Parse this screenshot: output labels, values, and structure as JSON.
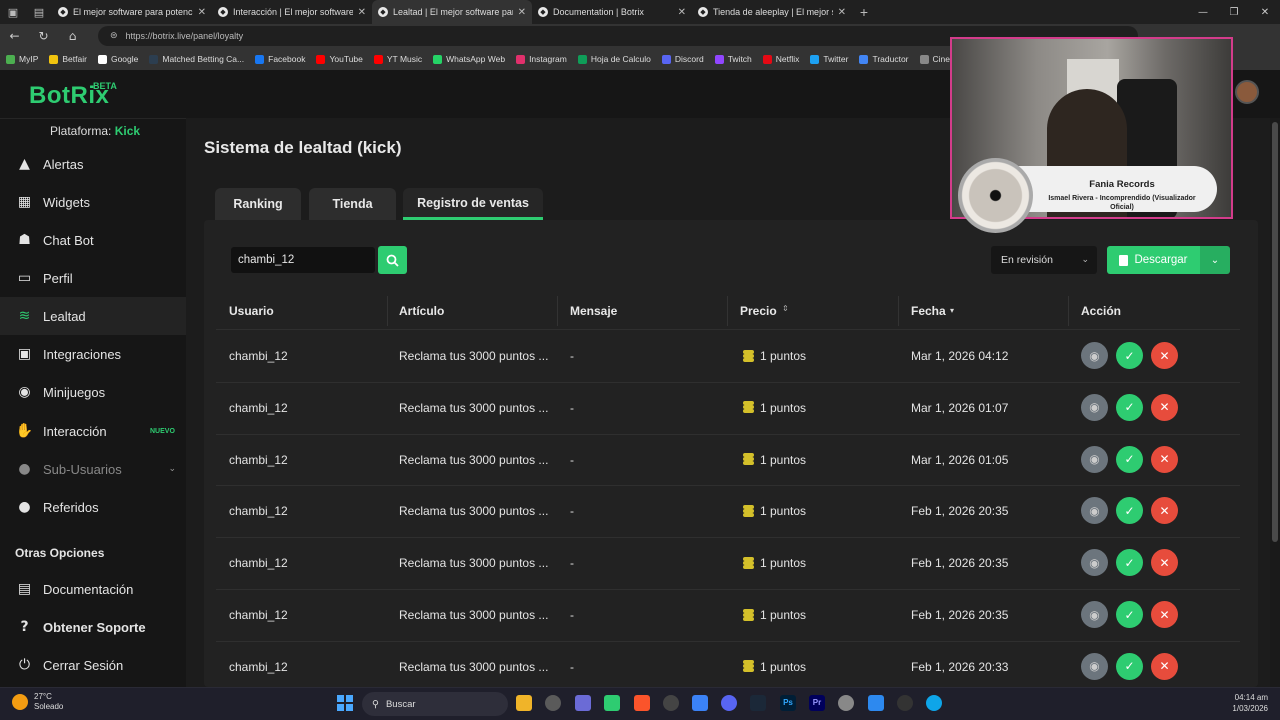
{
  "browser": {
    "tabs": [
      {
        "title": "El mejor software para potenciar"
      },
      {
        "title": "Interacción | El mejor software pa"
      },
      {
        "title": "Lealtad | El mejor software para p"
      },
      {
        "title": "Documentation | Botrix"
      },
      {
        "title": "Tienda de aleeplay | El mejor softw"
      }
    ],
    "active_tab": 2,
    "url": "https://botrix.live/panel/loyalty",
    "bookmarks": [
      {
        "label": "MyIP",
        "color": "#4caf50"
      },
      {
        "label": "Betfair",
        "color": "#f1c40f"
      },
      {
        "label": "Google",
        "color": "#ffffff"
      },
      {
        "label": "Matched Betting Ca...",
        "color": "#2c3e50"
      },
      {
        "label": "Facebook",
        "color": "#1877f2"
      },
      {
        "label": "YouTube",
        "color": "#ff0000"
      },
      {
        "label": "YT Music",
        "color": "#ff0000"
      },
      {
        "label": "WhatsApp Web",
        "color": "#25d366"
      },
      {
        "label": "Instagram",
        "color": "#e1306c"
      },
      {
        "label": "Hoja de Calculo",
        "color": "#0f9d58"
      },
      {
        "label": "Discord",
        "color": "#5865f2"
      },
      {
        "label": "Twitch",
        "color": "#9146ff"
      },
      {
        "label": "Netflix",
        "color": "#e50914"
      },
      {
        "label": "Twitter",
        "color": "#1da1f2"
      },
      {
        "label": "Traductor",
        "color": "#4285f4"
      },
      {
        "label": "Cinepl",
        "color": "#888888"
      }
    ]
  },
  "sidebar": {
    "logo": "BotRix",
    "beta": "BETA",
    "platform_label": "Plataforma:",
    "platform_value": "Kick",
    "items": [
      {
        "label": "Alertas",
        "icon": "warning-icon"
      },
      {
        "label": "Widgets",
        "icon": "grid-icon"
      },
      {
        "label": "Chat Bot",
        "icon": "robot-icon"
      },
      {
        "label": "Perfil",
        "icon": "id-card-icon"
      },
      {
        "label": "Lealtad",
        "icon": "coins-icon"
      },
      {
        "label": "Integraciones",
        "icon": "plug-icon"
      },
      {
        "label": "Minijuegos",
        "icon": "gamepad-icon"
      },
      {
        "label": "Interacción",
        "icon": "hand-icon",
        "badge": "NUEVO"
      },
      {
        "label": "Sub-Usuarios",
        "icon": "users-icon"
      },
      {
        "label": "Referidos",
        "icon": "people-icon"
      }
    ],
    "other_heading": "Otras Opciones",
    "other_items": [
      {
        "label": "Documentación",
        "icon": "book-icon"
      },
      {
        "label": "Obtener Soporte",
        "icon": "help-icon"
      },
      {
        "label": "Cerrar Sesión",
        "icon": "power-icon"
      }
    ]
  },
  "page": {
    "title": "Sistema de lealtad (kick)",
    "tabs": [
      "Ranking",
      "Tienda",
      "Registro de ventas"
    ],
    "search_value": "chambi_12",
    "status_select": "En revisión",
    "download_label": "Descargar",
    "columns": [
      "Usuario",
      "Artículo",
      "Mensaje",
      "Precio",
      "Fecha",
      "Acción"
    ],
    "rows": [
      {
        "user": "chambi_12",
        "item": "Reclama tus 3000 puntos ...",
        "message": "-",
        "price": "1 puntos",
        "date": "Mar 1, 2026 04:12"
      },
      {
        "user": "chambi_12",
        "item": "Reclama tus 3000 puntos ...",
        "message": "-",
        "price": "1 puntos",
        "date": "Mar 1, 2026 01:07"
      },
      {
        "user": "chambi_12",
        "item": "Reclama tus 3000 puntos ...",
        "message": "-",
        "price": "1 puntos",
        "date": "Mar 1, 2026 01:05"
      },
      {
        "user": "chambi_12",
        "item": "Reclama tus 3000 puntos ...",
        "message": "-",
        "price": "1 puntos",
        "date": "Feb 1, 2026 20:35"
      },
      {
        "user": "chambi_12",
        "item": "Reclama tus 3000 puntos ...",
        "message": "-",
        "price": "1 puntos",
        "date": "Feb 1, 2026 20:35"
      },
      {
        "user": "chambi_12",
        "item": "Reclama tus 3000 puntos ...",
        "message": "-",
        "price": "1 puntos",
        "date": "Feb 1, 2026 20:35"
      },
      {
        "user": "chambi_12",
        "item": "Reclama tus 3000 puntos ...",
        "message": "-",
        "price": "1 puntos",
        "date": "Feb 1, 2026 20:33"
      }
    ]
  },
  "overlay": {
    "song_title": "Fania Records",
    "song_subtitle": "Ismael Rivera - Incomprendido (Visualizador Oficial)"
  },
  "taskbar": {
    "temperature": "27°C",
    "weather": "Soleado",
    "search": "Buscar",
    "time": "04:14 am",
    "date": "1/03/2026"
  },
  "colors": {
    "accent": "#2ecc71",
    "danger": "#e74c3c",
    "neutral": "#6c757d"
  }
}
